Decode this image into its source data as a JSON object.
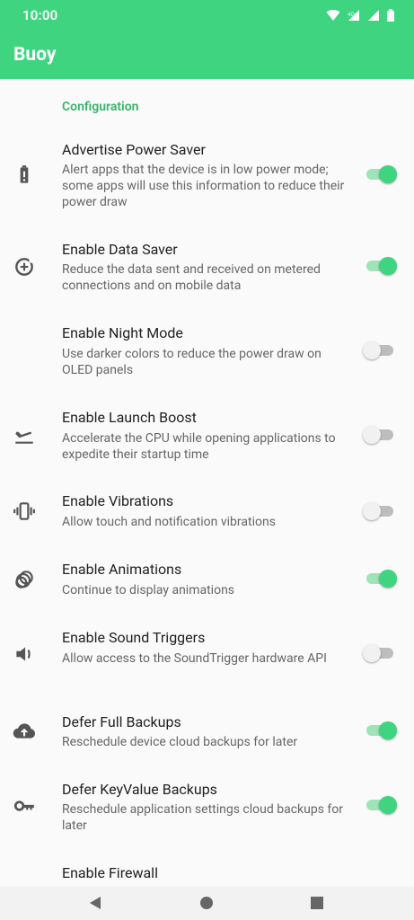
{
  "status_bar": {
    "time": "10:00"
  },
  "app_bar": {
    "title": "Buoy"
  },
  "section": {
    "label": "Configuration"
  },
  "items": [
    {
      "title": "Advertise Power Saver",
      "subtitle": "Alert apps that the device is in low power mode; some apps will use this information to reduce their power draw",
      "icon": "battery-saver-icon",
      "enabled": true
    },
    {
      "title": "Enable Data Saver",
      "subtitle": "Reduce the data sent and received on metered connections and on mobile data",
      "icon": "data-saver-icon",
      "enabled": true
    },
    {
      "title": "Enable Night Mode",
      "subtitle": "Use darker colors to reduce the power draw on OLED panels",
      "icon": "night-mode-icon",
      "enabled": false
    },
    {
      "title": "Enable Launch Boost",
      "subtitle": "Accelerate the CPU while opening applications to expedite their startup time",
      "icon": "launch-icon",
      "enabled": false
    },
    {
      "title": "Enable Vibrations",
      "subtitle": "Allow touch and notification vibrations",
      "icon": "vibration-icon",
      "enabled": false
    },
    {
      "title": "Enable Animations",
      "subtitle": "Continue to display animations",
      "icon": "animation-icon",
      "enabled": true
    },
    {
      "title": "Enable Sound Triggers",
      "subtitle": "Allow access to the SoundTrigger hardware API",
      "icon": "volume-icon",
      "enabled": false
    },
    {
      "title": "Defer Full Backups",
      "subtitle": "Reschedule device cloud backups for later",
      "icon": "cloud-upload-icon",
      "enabled": true
    },
    {
      "title": "Defer KeyValue Backups",
      "subtitle": "Reschedule application settings cloud backups for later",
      "icon": "key-icon",
      "enabled": true
    },
    {
      "title": "Enable Firewall",
      "subtitle": "",
      "icon": "firewall-icon",
      "enabled": false
    }
  ],
  "colors": {
    "accent": "#3ed480",
    "section": "#36b36a"
  }
}
